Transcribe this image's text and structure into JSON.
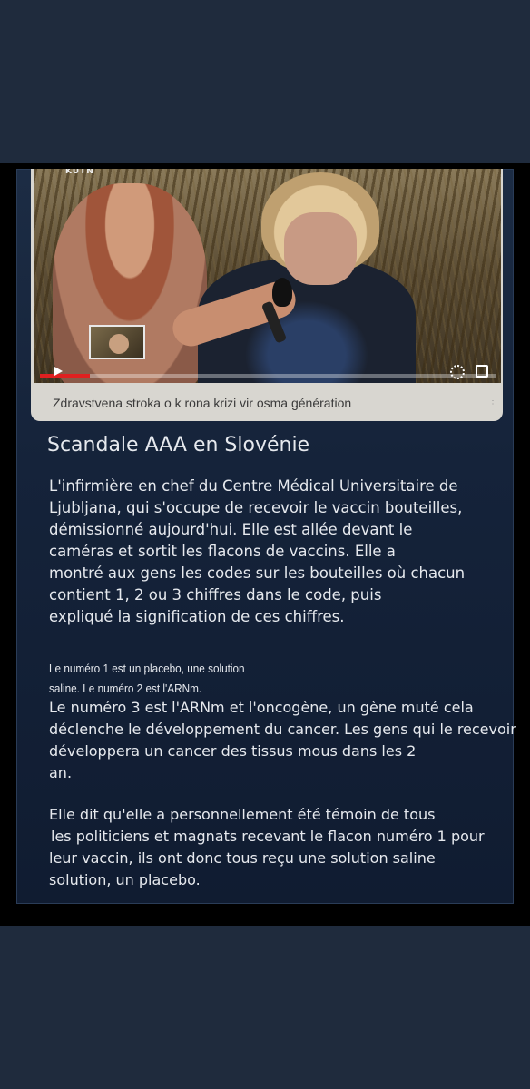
{
  "video": {
    "caption": "Zdravstvena stroka o k rona krizi vir osma génération",
    "logo_text": "KUTN",
    "progress_fraction": 0.11
  },
  "article": {
    "headline": "Scandale AAA en Slovénie",
    "paragraph1": [
      "L'infirmière en chef du Centre Médical Universitaire de",
      "Ljubljana, qui s'occupe de recevoir le vaccin bouteilles,",
      "démissionné aujourd'hui. Elle est allée devant le",
      "caméras et sortit les flacons de vaccins. Elle a",
      "montré aux gens les codes sur les bouteilles où chacun",
      "contient 1, 2 ou 3 chiffres dans le code, puis",
      "expliqué la signification de ces chiffres."
    ],
    "small_lines": [
      "Le numéro 1 est un placebo, une solution",
      "saline. Le numéro 2 est l'ARNm."
    ],
    "paragraph2": [
      "Le numéro 3 est l'ARNm et l'oncogène, un gène muté cela",
      "déclenche le développement du cancer. Les gens qui le recevoir",
      "développera un cancer des tissus mous dans les 2",
      "an."
    ],
    "paragraph3": [
      "Elle dit qu'elle a personnellement été témoin de tous",
      "les politiciens et magnats recevant le flacon numéro 1 pour",
      "leur vaccin, ils ont donc tous reçu une solution saline",
      "solution, un placebo."
    ]
  },
  "colors": {
    "page_background": "#1f2b3d",
    "panel_background": "#15233a",
    "text": "#e6e9ee",
    "progress": "#e02020"
  }
}
